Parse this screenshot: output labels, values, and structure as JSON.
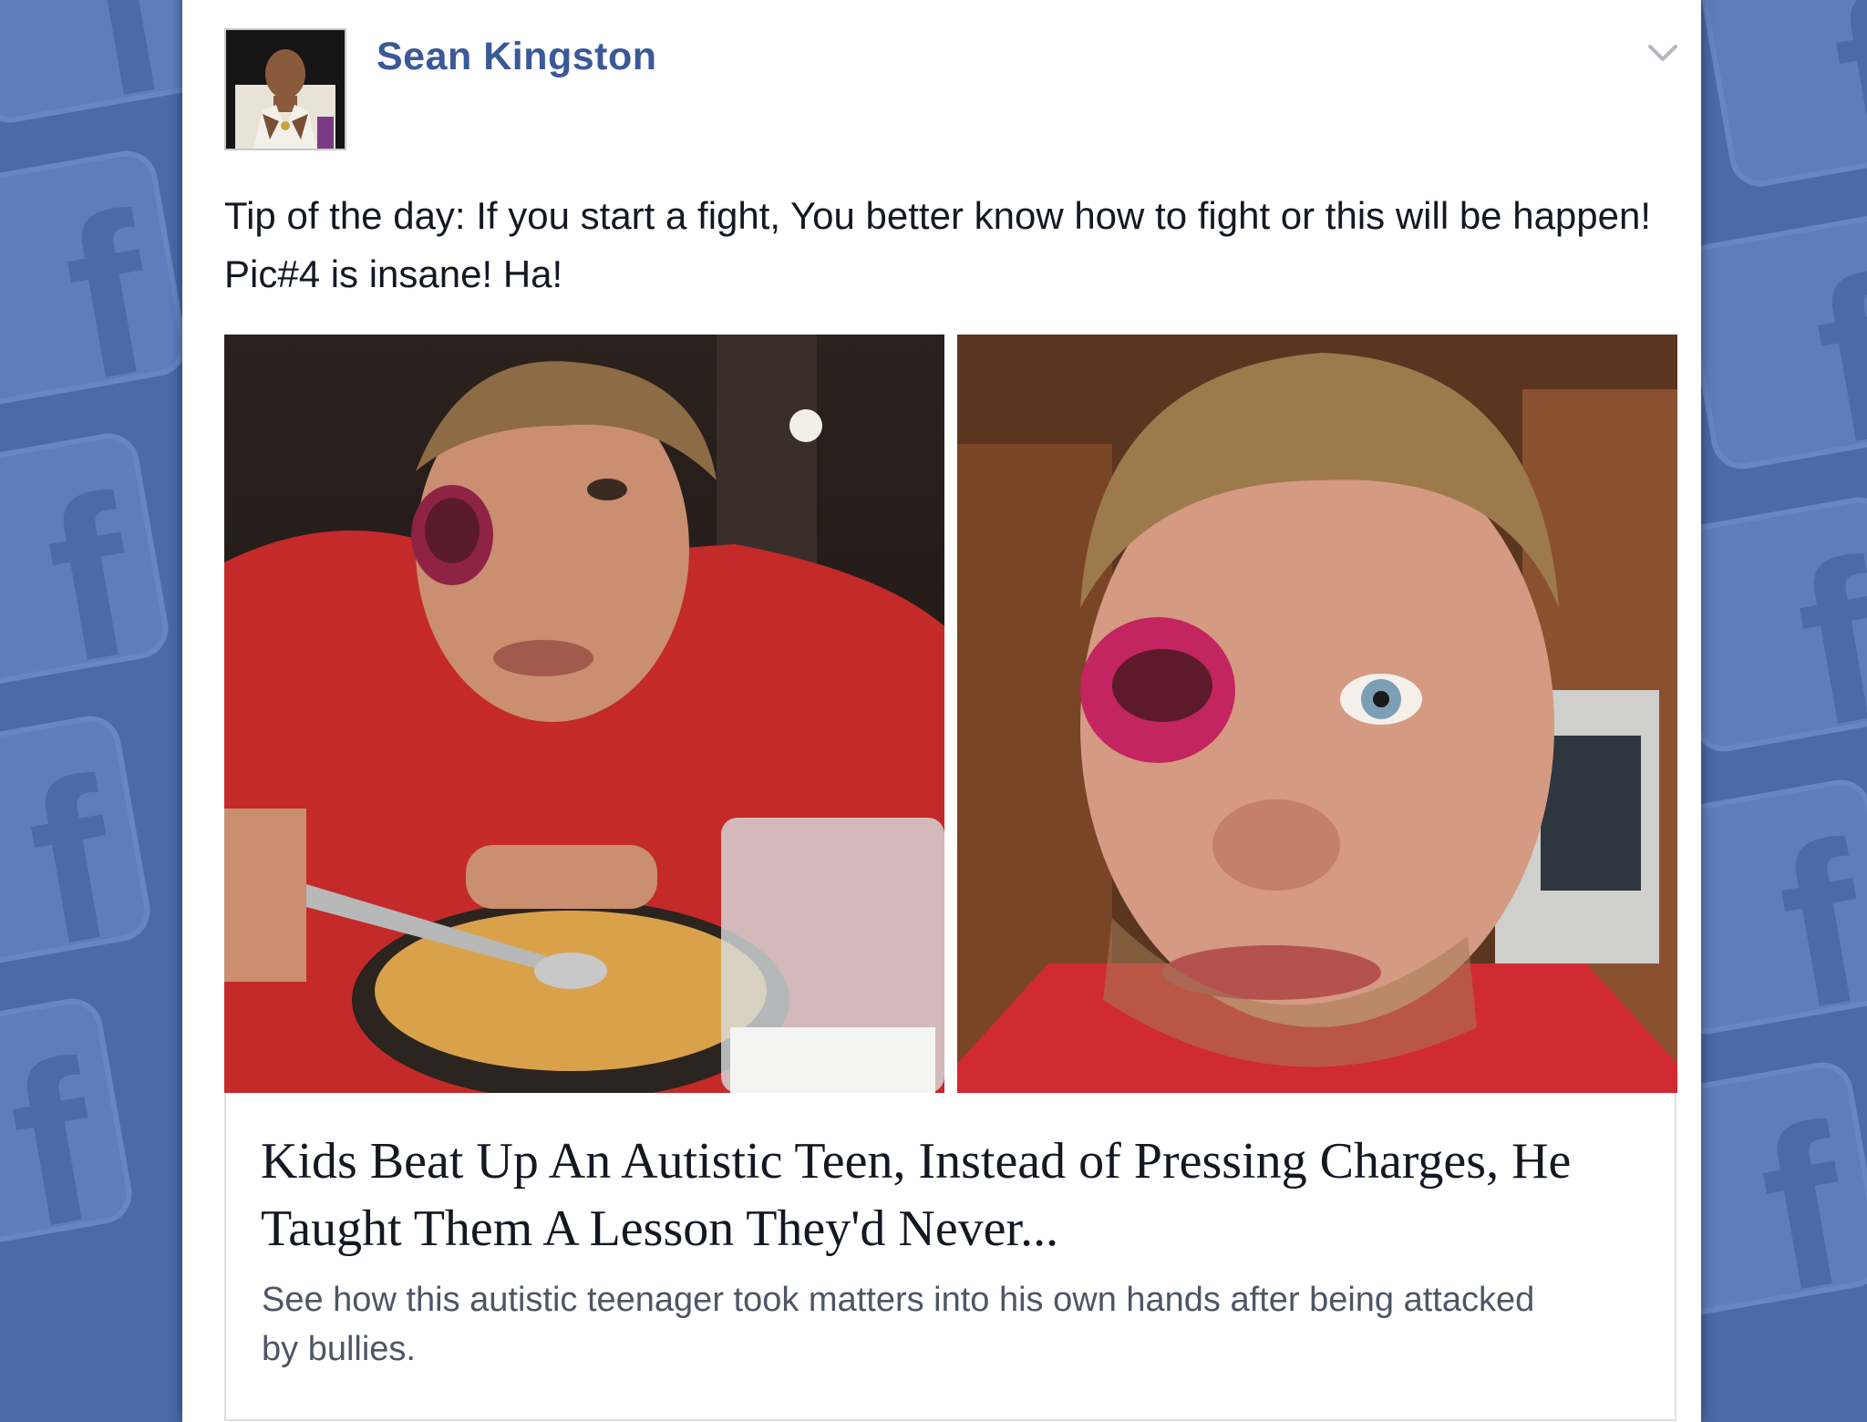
{
  "post": {
    "author": "Sean Kingston",
    "text": "Tip of the day: If you start a fight, You better know how to fight or this will be happen! Pic#4 is insane! Ha!"
  },
  "link_preview": {
    "title": "Kids Beat Up An Autistic Teen, Instead of Pressing Charges, He Taught Them A Lesson They'd Never...",
    "description": "See how this autistic teenager took matters into his own hands after being attacked by bullies."
  },
  "icons": {
    "options_menu": "chevron-down-icon",
    "background": "facebook-logo-icon"
  },
  "colors": {
    "author_link": "#3b5998",
    "background": "#4a6aa8"
  }
}
